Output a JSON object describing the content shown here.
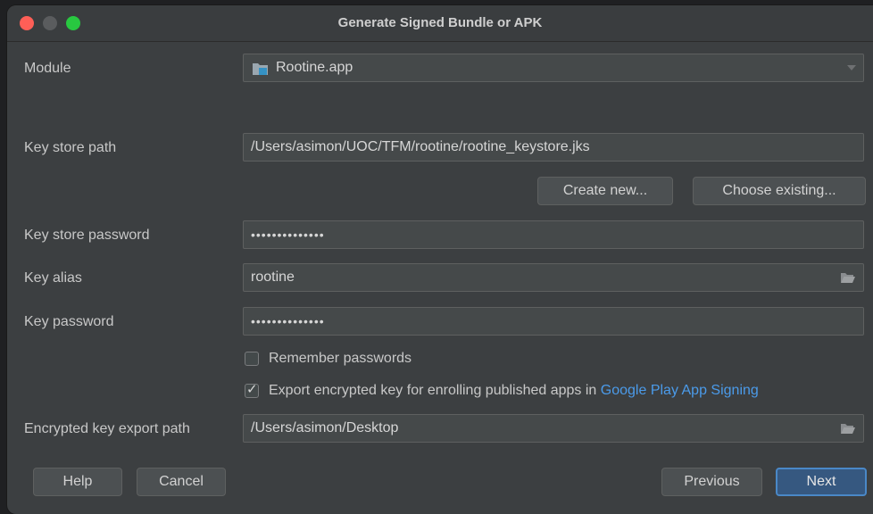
{
  "window": {
    "title": "Generate Signed Bundle or APK"
  },
  "module": {
    "label": "Module",
    "value": "Rootine.app",
    "icon": "module-folder-icon"
  },
  "key_store_path": {
    "label": "Key store path",
    "value": "/Users/asimon/UOC/TFM/rootine/rootine_keystore.jks"
  },
  "key_store_buttons": {
    "create_new": "Create new...",
    "choose_existing": "Choose existing..."
  },
  "key_store_password": {
    "label": "Key store password",
    "value": "••••••••••••••"
  },
  "key_alias": {
    "label": "Key alias",
    "value": "rootine"
  },
  "key_password": {
    "label": "Key password",
    "value": "••••••••••••••"
  },
  "remember_passwords": {
    "label": "Remember passwords",
    "checked": false
  },
  "export_encrypted_key": {
    "label": "Export encrypted key for enrolling published apps in",
    "link": "Google Play App Signing",
    "checked": true,
    "checkmark": "✓"
  },
  "encrypted_key_export_path": {
    "label": "Encrypted key export path",
    "value": "/Users/asimon/Desktop"
  },
  "footer": {
    "help": "Help",
    "cancel": "Cancel",
    "previous": "Previous",
    "next": "Next"
  },
  "colors": {
    "window_bg": "#3c3f41",
    "field_bg": "#45494a",
    "primary_button": "#365880",
    "link": "#4b9bea",
    "close": "#fe5f57",
    "maximize": "#28c840"
  }
}
